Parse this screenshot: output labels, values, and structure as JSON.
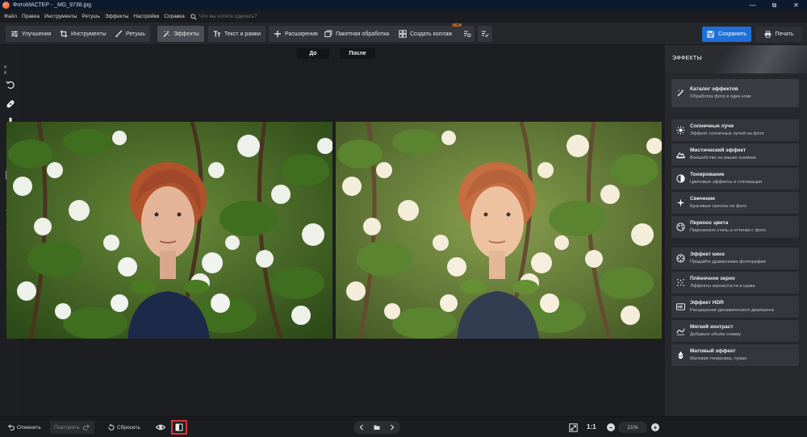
{
  "window": {
    "title": "ФотоМАСТЕР - _MG_9738.jpg"
  },
  "menu": {
    "items": [
      "Файл",
      "Правка",
      "Инструменты",
      "Ретушь",
      "Эффекты",
      "Настройки",
      "Справка"
    ],
    "search_placeholder": "Что вы хотите сделать?"
  },
  "toolbar": {
    "tabs": [
      "Улучшения",
      "Инструменты",
      "Ретушь",
      "Эффекты",
      "Текст и рамки",
      "Расширения"
    ],
    "active_tab": "Эффекты",
    "batch_label": "Пакетная обработка",
    "collage_label": "Создать коллаж",
    "collage_badge": "NEW",
    "save_label": "Сохранить",
    "print_label": "Печать"
  },
  "canvas": {
    "before_label": "До",
    "after_label": "После"
  },
  "panel": {
    "title": "ЭФФЕКТЫ",
    "catalog": {
      "name": "Каталог эффектов",
      "desc": "Обработка фото в один клик",
      "icon": "magic-wand-icon"
    },
    "effects": [
      {
        "name": "Солнечные лучи",
        "desc": "Эффект солнечных лучей на фото",
        "icon": "sun-icon"
      },
      {
        "name": "Мистический эффект",
        "desc": "Волшебство на ваших снимках",
        "icon": "mountain-icon"
      },
      {
        "name": "Тонирование",
        "desc": "Цветовые эффекты и стилизация",
        "icon": "half-circle-icon"
      },
      {
        "name": "Свечение",
        "desc": "Красивые ореолы на фото",
        "icon": "glow-icon"
      },
      {
        "name": "Перенос цвета",
        "desc": "Перенесите стиль и оттенки с фото",
        "icon": "color-transfer-icon"
      },
      {
        "name": "Эффект кино",
        "desc": "Придайте драматизма фотографии",
        "icon": "film-reel-icon"
      },
      {
        "name": "Плёночное зерно",
        "desc": "Эффекты зернистости и шума",
        "icon": "grain-icon"
      },
      {
        "name": "Эффект HDR",
        "desc": "Расширение динамического диапазона",
        "icon": "hdr-icon"
      },
      {
        "name": "Мягкий контраст",
        "desc": "Добавьте объём снимку",
        "icon": "contrast-icon"
      },
      {
        "name": "Матовый эффект",
        "desc": "Матовая тонировка, туман",
        "icon": "matte-icon"
      }
    ]
  },
  "bottom": {
    "undo_label": "Отменить",
    "redo_label": "Повторить",
    "reset_label": "Сбросить",
    "ratio_label": "1:1",
    "zoom_value": "21%"
  },
  "colors": {
    "accent": "#1e6fd6",
    "badge": "#ff8a1c",
    "highlight_border": "#e03434"
  }
}
